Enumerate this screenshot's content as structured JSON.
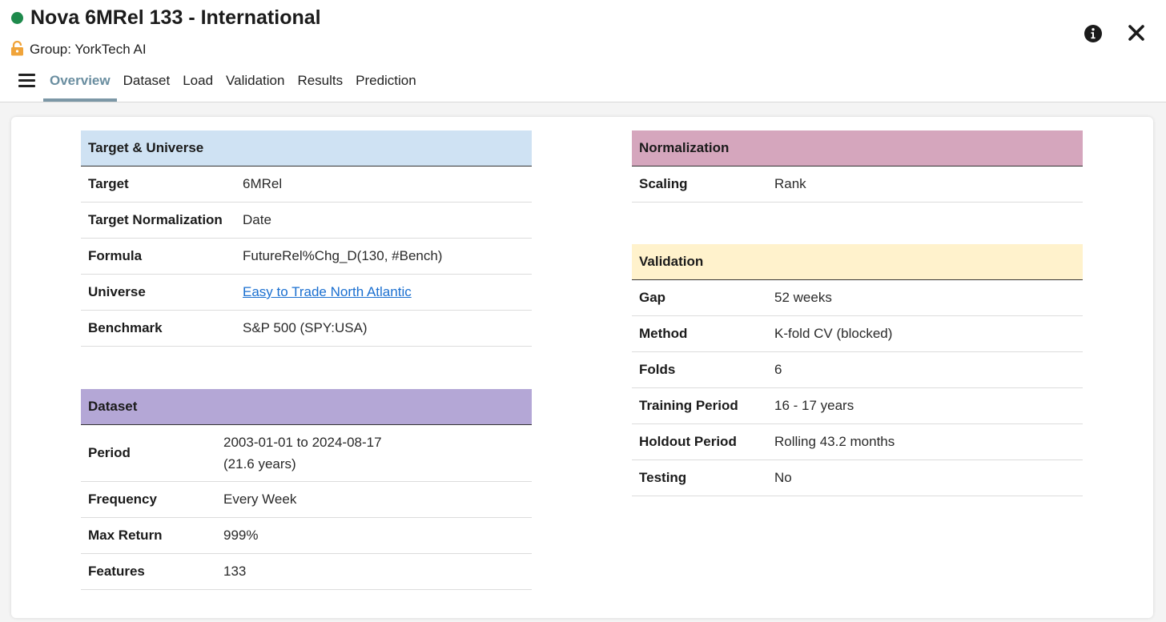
{
  "header": {
    "title": "Nova 6MRel 133 - International",
    "group": "Group: YorkTech AI",
    "status_color": "#1e8a4c"
  },
  "tabs": [
    {
      "label": "Overview",
      "active": true
    },
    {
      "label": "Dataset"
    },
    {
      "label": "Load"
    },
    {
      "label": "Validation"
    },
    {
      "label": "Results"
    },
    {
      "label": "Prediction"
    }
  ],
  "icons": {
    "menu": "hamburger-icon",
    "lock": "lock-icon",
    "info": "info-icon",
    "close": "close-icon"
  },
  "target_universe": {
    "title": "Target & Universe",
    "color": "#cfe2f3",
    "rows": [
      {
        "label": "Target",
        "value": "6MRel"
      },
      {
        "label": "Target Normalization",
        "value": "Date"
      },
      {
        "label": "Formula",
        "value": "FutureRel%Chg_D(130, #Bench)"
      },
      {
        "label": "Universe",
        "value": "Easy to Trade North Atlantic"
      },
      {
        "label": "Benchmark",
        "value": "S&P 500 (SPY:USA)"
      }
    ]
  },
  "dataset": {
    "title": "Dataset",
    "color": "#b4a7d6",
    "period_label": "Period",
    "period_value": "2003-01-01 to 2024-08-17",
    "period_years": "(21.6 years)",
    "rows": [
      {
        "label": "Frequency",
        "value": "Every Week"
      },
      {
        "label": "Max Return",
        "value": "999%"
      },
      {
        "label": "Features",
        "value": "133"
      }
    ]
  },
  "normalization": {
    "title": "Normalization",
    "color": "#d5a6bd",
    "rows": [
      {
        "label": "Scaling",
        "value": "Rank"
      }
    ]
  },
  "validation": {
    "title": "Validation",
    "color": "#fff2cc",
    "rows": [
      {
        "label": "Gap",
        "value": "52 weeks"
      },
      {
        "label": "Method",
        "value": "K-fold CV (blocked)"
      },
      {
        "label": "Folds",
        "value": "6"
      },
      {
        "label": "Training Period",
        "value": "16 - 17 years"
      },
      {
        "label": "Holdout Period",
        "value": "Rolling 43.2 months"
      },
      {
        "label": "Testing",
        "value": "No"
      }
    ]
  }
}
